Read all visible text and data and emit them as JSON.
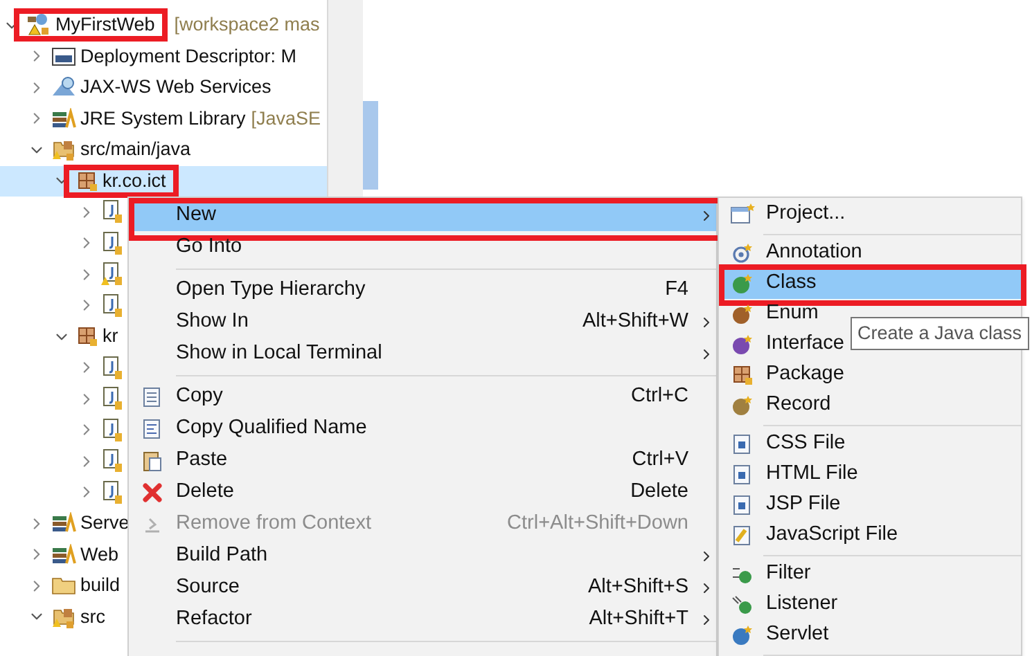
{
  "tree": [
    {
      "label": "MyFirstWeb",
      "suffix": "[workspace2 mas",
      "kind": "project",
      "expanded": true,
      "selected": false,
      "framed": true,
      "children": [
        {
          "label": "Deployment Descriptor: M",
          "kind": "descriptor",
          "expanded": false,
          "selected": false
        },
        {
          "label": "JAX-WS Web Services",
          "kind": "webservice",
          "expanded": false,
          "selected": false
        },
        {
          "label": "JRE System Library",
          "suffix": "[JavaSE",
          "kind": "library",
          "expanded": false,
          "selected": false
        },
        {
          "label": "src/main/java",
          "kind": "source-folder",
          "expanded": true,
          "selected": false,
          "children": [
            {
              "label": "kr.co.ict",
              "kind": "package",
              "expanded": true,
              "selected": true,
              "framed": true,
              "children": [
                {
                  "kind": "java-file",
                  "expanded": false,
                  "selected": false
                },
                {
                  "kind": "java-file",
                  "expanded": false,
                  "selected": false
                },
                {
                  "kind": "java-file-warning",
                  "expanded": false,
                  "selected": false
                },
                {
                  "kind": "java-file",
                  "expanded": false,
                  "selected": false
                }
              ]
            },
            {
              "label": "kr",
              "kind": "package",
              "expanded": true,
              "selected": false,
              "children": [
                {
                  "kind": "java-file",
                  "expanded": false,
                  "selected": false
                },
                {
                  "kind": "java-file",
                  "expanded": false,
                  "selected": false
                },
                {
                  "kind": "java-file",
                  "expanded": false,
                  "selected": false
                },
                {
                  "kind": "java-file",
                  "expanded": false,
                  "selected": false
                },
                {
                  "kind": "java-file",
                  "expanded": false,
                  "selected": false
                }
              ]
            }
          ]
        },
        {
          "label": "Serve",
          "kind": "library",
          "expanded": false,
          "selected": false
        },
        {
          "label": "Web",
          "kind": "library",
          "expanded": false,
          "selected": false
        },
        {
          "label": "build",
          "kind": "folder",
          "expanded": false,
          "selected": false
        },
        {
          "label": "src",
          "kind": "source-folder",
          "expanded": true,
          "selected": false
        }
      ]
    }
  ],
  "context_menu": [
    {
      "kind": "plain",
      "label": "New",
      "submenu": true,
      "selected": true,
      "framed": true
    },
    {
      "kind": "plain",
      "label": "Go Into",
      "selected": false
    },
    {
      "kind": "separator"
    },
    {
      "kind": "plain",
      "label": "Open Type Hierarchy",
      "shortcut": "F4",
      "selected": false
    },
    {
      "kind": "plain",
      "label": "Show In",
      "shortcut": "Alt+Shift+W",
      "submenu": true,
      "selected": false
    },
    {
      "kind": "plain",
      "label": "Show in Local Terminal",
      "submenu": true,
      "selected": false
    },
    {
      "kind": "separator"
    },
    {
      "kind": "copy",
      "label": "Copy",
      "shortcut": "Ctrl+C",
      "selected": false
    },
    {
      "kind": "copy-name",
      "label": "Copy Qualified Name",
      "selected": false
    },
    {
      "kind": "paste",
      "label": "Paste",
      "shortcut": "Ctrl+V",
      "selected": false
    },
    {
      "kind": "delete",
      "label": "Delete",
      "shortcut": "Delete",
      "selected": false
    },
    {
      "kind": "remove",
      "label": "Remove from Context",
      "shortcut": "Ctrl+Alt+Shift+Down",
      "disabled": true,
      "selected": false
    },
    {
      "kind": "plain",
      "label": "Build Path",
      "submenu": true,
      "selected": false
    },
    {
      "kind": "plain",
      "label": "Source",
      "shortcut": "Alt+Shift+S",
      "submenu": true,
      "selected": false
    },
    {
      "kind": "plain",
      "label": "Refactor",
      "shortcut": "Alt+Shift+T",
      "submenu": true,
      "selected": false
    },
    {
      "kind": "separator"
    }
  ],
  "new_submenu": [
    {
      "kind": "project-new",
      "label": "Project...",
      "selected": false
    },
    {
      "kind": "separator"
    },
    {
      "kind": "annotation",
      "label": "Annotation",
      "selected": false
    },
    {
      "kind": "class",
      "label": "Class",
      "selected": true,
      "framed": true
    },
    {
      "kind": "enum",
      "label": "Enum",
      "selected": false
    },
    {
      "kind": "interface",
      "label": "Interface",
      "selected": false
    },
    {
      "kind": "package-new",
      "label": "Package",
      "selected": false
    },
    {
      "kind": "record",
      "label": "Record",
      "selected": false
    },
    {
      "kind": "separator"
    },
    {
      "kind": "css",
      "label": "CSS File",
      "selected": false
    },
    {
      "kind": "html",
      "label": "HTML File",
      "selected": false
    },
    {
      "kind": "jsp",
      "label": "JSP File",
      "selected": false
    },
    {
      "kind": "js",
      "label": "JavaScript File",
      "selected": false
    },
    {
      "kind": "separator"
    },
    {
      "kind": "filter",
      "label": "Filter",
      "selected": false
    },
    {
      "kind": "listener",
      "label": "Listener",
      "selected": false
    },
    {
      "kind": "servlet",
      "label": "Servlet",
      "selected": false
    },
    {
      "kind": "separator"
    }
  ],
  "tooltip": "Create a Java class"
}
